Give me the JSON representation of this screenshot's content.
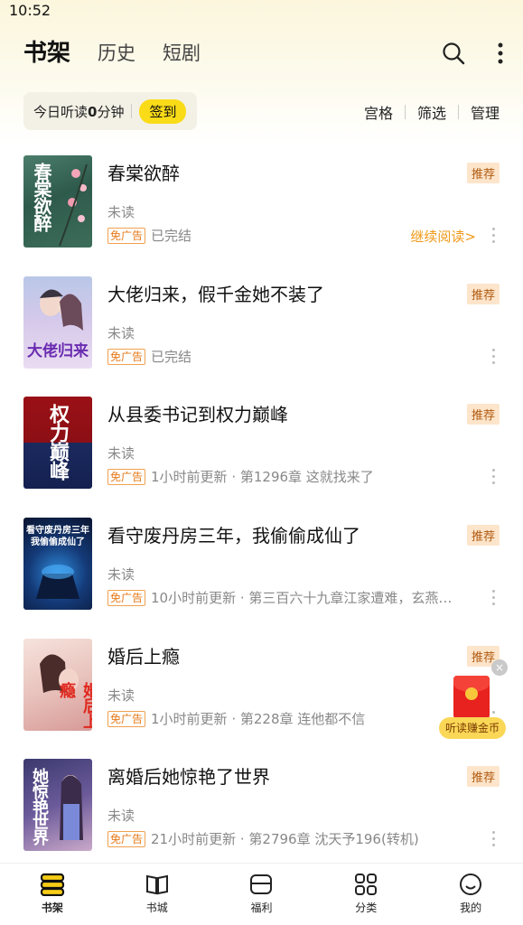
{
  "status_bar": {
    "time": "10:52"
  },
  "header": {
    "tabs": [
      {
        "label": "书架",
        "active": true
      },
      {
        "label": "历史",
        "active": false
      },
      {
        "label": "短剧",
        "active": false
      }
    ],
    "icons": [
      "search-icon",
      "more-vertical-icon"
    ]
  },
  "listen": {
    "prefix": "今日听读",
    "minutes": "0",
    "suffix": "分钟",
    "checkin_label": "签到"
  },
  "actions": {
    "grid": "宫格",
    "filter": "筛选",
    "manage": "管理"
  },
  "books": [
    {
      "title": "春棠欲醉",
      "badge": "推荐",
      "progress": "未读",
      "ad_free": "免广告",
      "meta": "已完结",
      "continue": "继续阅读>",
      "cover_text": "春棠欲醉"
    },
    {
      "title": "大佬归来，假千金她不装了",
      "badge": "推荐",
      "progress": "未读",
      "ad_free": "免广告",
      "meta": "已完结",
      "cover_text": "大佬归来"
    },
    {
      "title": "从县委书记到权力巅峰",
      "badge": "推荐",
      "progress": "未读",
      "ad_free": "免广告",
      "meta": "1小时前更新 · 第1296章  这就找来了",
      "cover_text": "权力巅峰"
    },
    {
      "title": "看守废丹房三年，我偷偷成仙了",
      "badge": "推荐",
      "progress": "未读",
      "ad_free": "免广告",
      "meta": "10小时前更新 · 第三百六十九章江家遭难，玄燕…",
      "cover_text": "看守废丹房三年我偷偷成仙了"
    },
    {
      "title": "婚后上瘾",
      "badge": "推荐",
      "progress": "未读",
      "ad_free": "免广告",
      "meta": "1小时前更新 · 第228章  连他都不信",
      "cover_text": "婚后上瘾"
    },
    {
      "title": "离婚后她惊艳了世界",
      "badge": "推荐",
      "progress": "未读",
      "ad_free": "免广告",
      "meta": "21小时前更新 · 第2796章  沈天予196(转机)",
      "cover_text": "她惊艳世界"
    }
  ],
  "floating_reward": {
    "label": "听读赚金币",
    "close": "×"
  },
  "bottom_nav": [
    {
      "label": "书架",
      "icon": "bookshelf-icon",
      "active": true
    },
    {
      "label": "书城",
      "icon": "book-open-icon",
      "active": false
    },
    {
      "label": "福利",
      "icon": "gift-icon",
      "active": false
    },
    {
      "label": "分类",
      "icon": "grid-icon",
      "active": false
    },
    {
      "label": "我的",
      "icon": "smiley-icon",
      "active": false
    }
  ],
  "colors": {
    "accent": "#f6cc16",
    "badge_bg": "#fde5cb",
    "badge_text": "#b15a10",
    "continue": "#f09a1a"
  }
}
